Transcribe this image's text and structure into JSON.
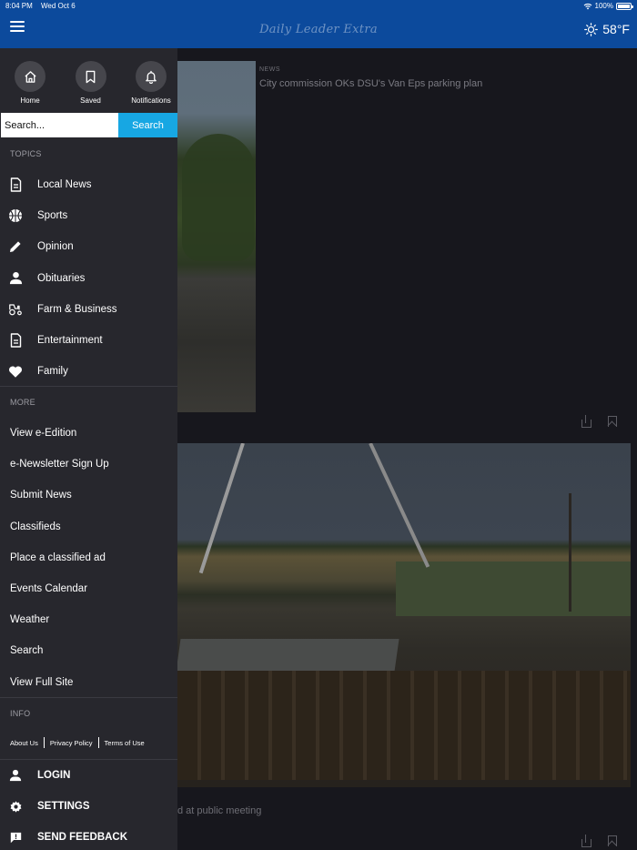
{
  "status_bar": {
    "time": "8:04 PM",
    "date": "Wed Oct 6",
    "battery": "100%"
  },
  "header": {
    "brand": "Daily Leader Extra",
    "temperature": "58°F"
  },
  "drawer": {
    "quick_actions": [
      {
        "label": "Home",
        "icon": "home-icon"
      },
      {
        "label": "Saved",
        "icon": "bookmark-icon"
      },
      {
        "label": "Notifications",
        "icon": "bell-icon"
      }
    ],
    "search": {
      "placeholder": "Search...",
      "button": "Search"
    },
    "topics_label": "TOPICS",
    "topics": [
      {
        "label": "Local News",
        "icon": "document-icon"
      },
      {
        "label": "Sports",
        "icon": "basketball-icon"
      },
      {
        "label": "Opinion",
        "icon": "pencil-icon"
      },
      {
        "label": "Obituaries",
        "icon": "person-icon"
      },
      {
        "label": "Farm & Business",
        "icon": "tractor-icon"
      },
      {
        "label": "Entertainment",
        "icon": "document-icon"
      },
      {
        "label": "Family",
        "icon": "heart-icon"
      }
    ],
    "more_label": "MORE",
    "more": [
      "View e-Edition",
      "e-Newsletter Sign Up",
      "Submit News",
      "Classifieds",
      "Place a classified ad",
      "Events Calendar",
      "Weather",
      "Search",
      "View Full Site"
    ],
    "info_label": "INFO",
    "info_links": [
      "About Us",
      "Privacy Policy",
      "Terms of Use"
    ],
    "bottom": [
      {
        "label": "LOGIN",
        "icon": "person-icon"
      },
      {
        "label": "SETTINGS",
        "icon": "gear-icon"
      },
      {
        "label": "SEND FEEDBACK",
        "icon": "feedback-icon"
      }
    ]
  },
  "feed": {
    "articles": [
      {
        "kicker": "NEWS",
        "headline": "City commission OKs DSU's Van Eps parking plan"
      },
      {
        "caption_fragment": "d at public meeting"
      }
    ]
  },
  "colors": {
    "header": "#0c4a9c",
    "drawer": "#27272d",
    "search_button": "#17a7e3",
    "background": "#16161b"
  }
}
